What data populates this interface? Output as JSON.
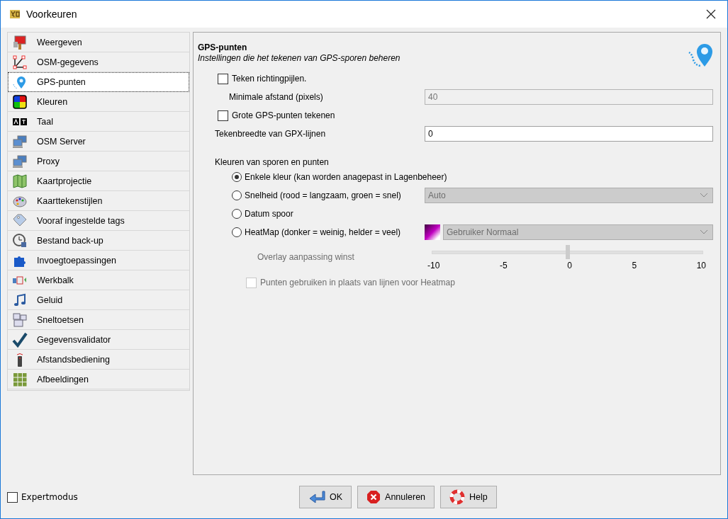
{
  "window": {
    "title": "Voorkeuren"
  },
  "sidebar": {
    "items": [
      {
        "label": "Weergeven",
        "selected": false
      },
      {
        "label": "OSM-gegevens",
        "selected": false
      },
      {
        "label": "GPS-punten",
        "selected": true
      },
      {
        "label": "Kleuren",
        "selected": false
      },
      {
        "label": "Taal",
        "selected": false
      },
      {
        "label": "OSM Server",
        "selected": false
      },
      {
        "label": "Proxy",
        "selected": false
      },
      {
        "label": "Kaartprojectie",
        "selected": false
      },
      {
        "label": "Kaarttekenstijlen",
        "selected": false
      },
      {
        "label": "Vooraf ingestelde tags",
        "selected": false
      },
      {
        "label": "Bestand back-up",
        "selected": false
      },
      {
        "label": "Invoegtoepassingen",
        "selected": false
      },
      {
        "label": "Werkbalk",
        "selected": false
      },
      {
        "label": "Geluid",
        "selected": false
      },
      {
        "label": "Sneltoetsen",
        "selected": false
      },
      {
        "label": "Gegevensvalidator",
        "selected": false
      },
      {
        "label": "Afstandsbediening",
        "selected": false
      },
      {
        "label": "Afbeeldingen",
        "selected": false
      }
    ]
  },
  "panel": {
    "title": "GPS-punten",
    "subtitle": "Instellingen die het tekenen van GPS-sporen beheren",
    "settings": [
      {
        "kind": "checkbox",
        "label": "Teken richtingpijlen.",
        "checked": false
      },
      {
        "kind": "field",
        "label": "Minimale afstand (pixels)",
        "value": "40",
        "disabled": true
      },
      {
        "kind": "checkbox",
        "label": "Grote GPS-punten tekenen",
        "checked": false
      },
      {
        "kind": "field",
        "label": "Tekenbreedte van GPX-lijnen",
        "value": "0",
        "disabled": false
      }
    ],
    "colors": {
      "heading": "Kleuren van sporen en punten",
      "options": [
        {
          "kind": "plain",
          "label": "Enkele kleur (kan worden anagepast in Lagenbeheer)",
          "selected": true
        },
        {
          "kind": "dropdown",
          "label": "Snelheid (rood = langzaam, groen = snel)",
          "selected": false,
          "value": "Auto",
          "disabled": true
        },
        {
          "kind": "plain",
          "label": "Datum spoor",
          "selected": false
        },
        {
          "kind": "heatmap",
          "label": "HeatMap (donker = weinig, helder = veel)",
          "selected": false,
          "value": "Gebruiker Normaal",
          "disabled": true
        }
      ]
    },
    "slider": {
      "label": "Overlay aanpassing winst",
      "level": 0.5,
      "disabled": true,
      "ticks": [
        "-10",
        "-5",
        "0",
        "5",
        "10"
      ]
    },
    "heatmap_points": {
      "label": "Punten gebruiken in plaats van lijnen voor Heatmap",
      "checked": false,
      "disabled": true
    }
  },
  "footer": {
    "expert": {
      "label": "Expertmodus",
      "checked": false
    },
    "buttons": [
      {
        "kind": "ok",
        "label": "OK"
      },
      {
        "kind": "cancel",
        "label": "Annuleren"
      },
      {
        "kind": "help",
        "label": "Help"
      }
    ]
  }
}
